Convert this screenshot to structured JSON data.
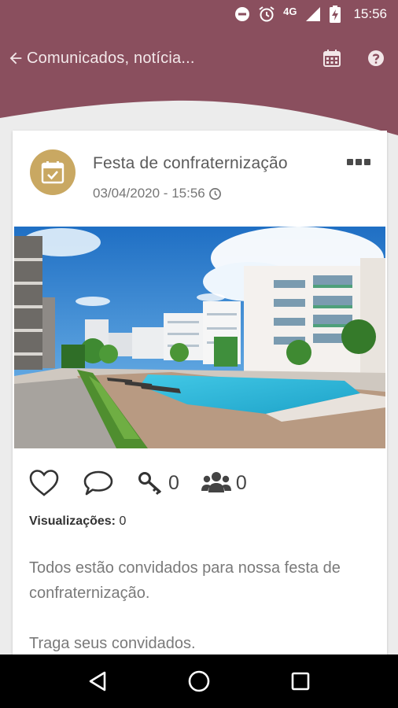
{
  "colors": {
    "brand": "#8a4f5e",
    "accent_gold": "#c9a862",
    "background": "#ececec"
  },
  "status_bar": {
    "network": "4G",
    "time": "15:56"
  },
  "app_bar": {
    "title": "Comunicados, notícia..."
  },
  "post": {
    "title": "Festa de confraternização",
    "date": "03/04/2020 - 15:56",
    "avatar_icon": "calendar-check-icon",
    "image_alt": "condominium-pool-photo",
    "actions": {
      "keys_count": "0",
      "groups_count": "0"
    },
    "views_label": "Visualizações:",
    "views_value": "0",
    "body_paragraphs": [
      "Todos estão convidados para nossa festa de confraternização.",
      "Traga seus convidados."
    ]
  }
}
